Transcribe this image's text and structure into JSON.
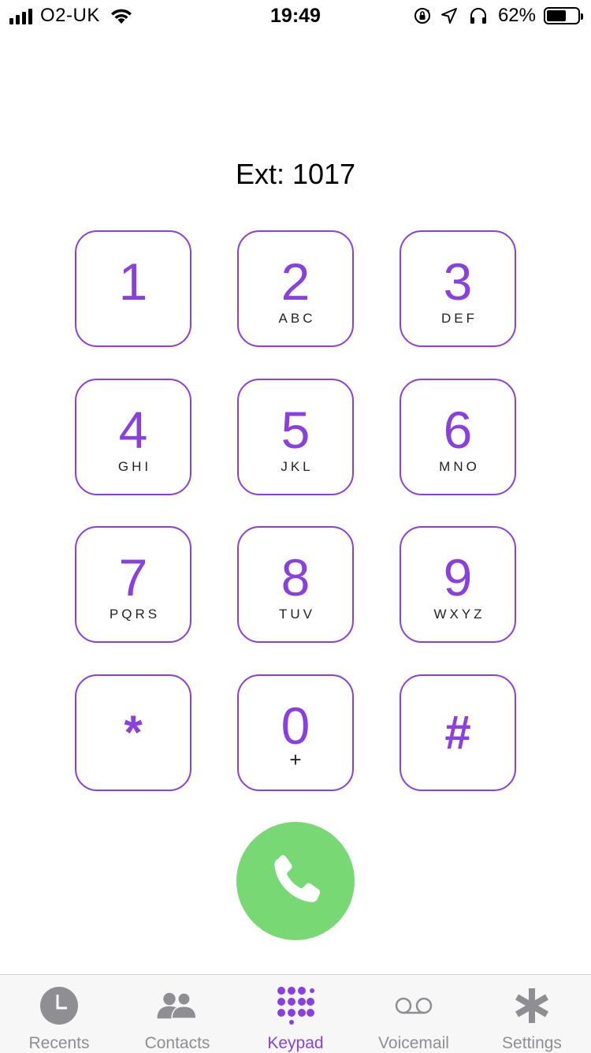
{
  "status_bar": {
    "carrier": "O2-UK",
    "time": "19:49",
    "battery_percent": "62%",
    "battery_level": 0.62,
    "icons": [
      "signal-icon",
      "wifi-icon",
      "orientation-lock-icon",
      "location-icon",
      "headphones-icon",
      "battery-icon"
    ]
  },
  "extension": {
    "label": "Ext: 1017"
  },
  "keypad": {
    "keys": [
      {
        "digit": "1",
        "letters": ""
      },
      {
        "digit": "2",
        "letters": "ABC"
      },
      {
        "digit": "3",
        "letters": "DEF"
      },
      {
        "digit": "4",
        "letters": "GHI"
      },
      {
        "digit": "5",
        "letters": "JKL"
      },
      {
        "digit": "6",
        "letters": "MNO"
      },
      {
        "digit": "7",
        "letters": "PQRS"
      },
      {
        "digit": "8",
        "letters": "TUV"
      },
      {
        "digit": "9",
        "letters": "WXYZ"
      },
      {
        "digit": "*",
        "letters": ""
      },
      {
        "digit": "0",
        "letters": "+"
      },
      {
        "digit": "#",
        "letters": ""
      }
    ],
    "accent_color": "#8a3fe0"
  },
  "call_button": {
    "icon": "phone-icon",
    "color": "#78d874"
  },
  "tab_bar": {
    "tabs": [
      {
        "label": "Recents",
        "icon": "clock-icon",
        "active": false
      },
      {
        "label": "Contacts",
        "icon": "people-icon",
        "active": false
      },
      {
        "label": "Keypad",
        "icon": "keypad-icon",
        "active": true
      },
      {
        "label": "Voicemail",
        "icon": "voicemail-icon",
        "active": false
      },
      {
        "label": "Settings",
        "icon": "asterisk-icon",
        "active": false
      }
    ],
    "active_color": "#8a3fe0",
    "inactive_color": "#8e8e93"
  }
}
